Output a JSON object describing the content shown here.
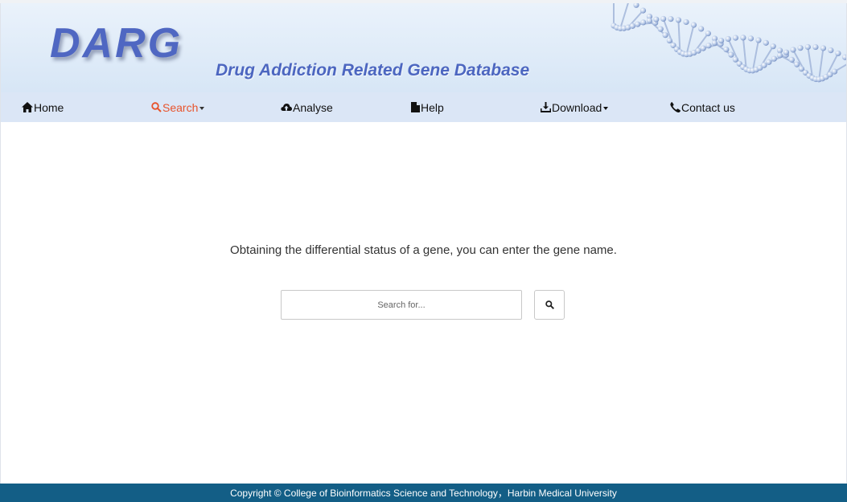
{
  "header": {
    "logo_text": "DARG",
    "subtitle": "Drug Addiction Related Gene Database"
  },
  "nav": {
    "items": [
      {
        "label": "Home",
        "icon": "home-icon"
      },
      {
        "label": "Search",
        "icon": "search-icon",
        "active": true,
        "dropdown": true
      },
      {
        "label": "Analyse",
        "icon": "cloud-upload-icon"
      },
      {
        "label": "Help",
        "icon": "file-icon"
      },
      {
        "label": "Download",
        "icon": "download-icon",
        "dropdown": true
      },
      {
        "label": "Contact us",
        "icon": "phone-icon"
      }
    ]
  },
  "main": {
    "intro": "Obtaining the differential status of a gene, you can enter the gene name.",
    "search": {
      "placeholder": "Search for...",
      "value": "",
      "button_icon": "search-icon"
    }
  },
  "footer": {
    "copyright": "Copyright © College of Bioinformatics Science and Technology，Harbin Medical University"
  },
  "colors": {
    "accent_active": "#e8532b",
    "logo": "#4f67c2",
    "nav_bg": "#dbe6f6",
    "footer_bg": "#135e86"
  }
}
